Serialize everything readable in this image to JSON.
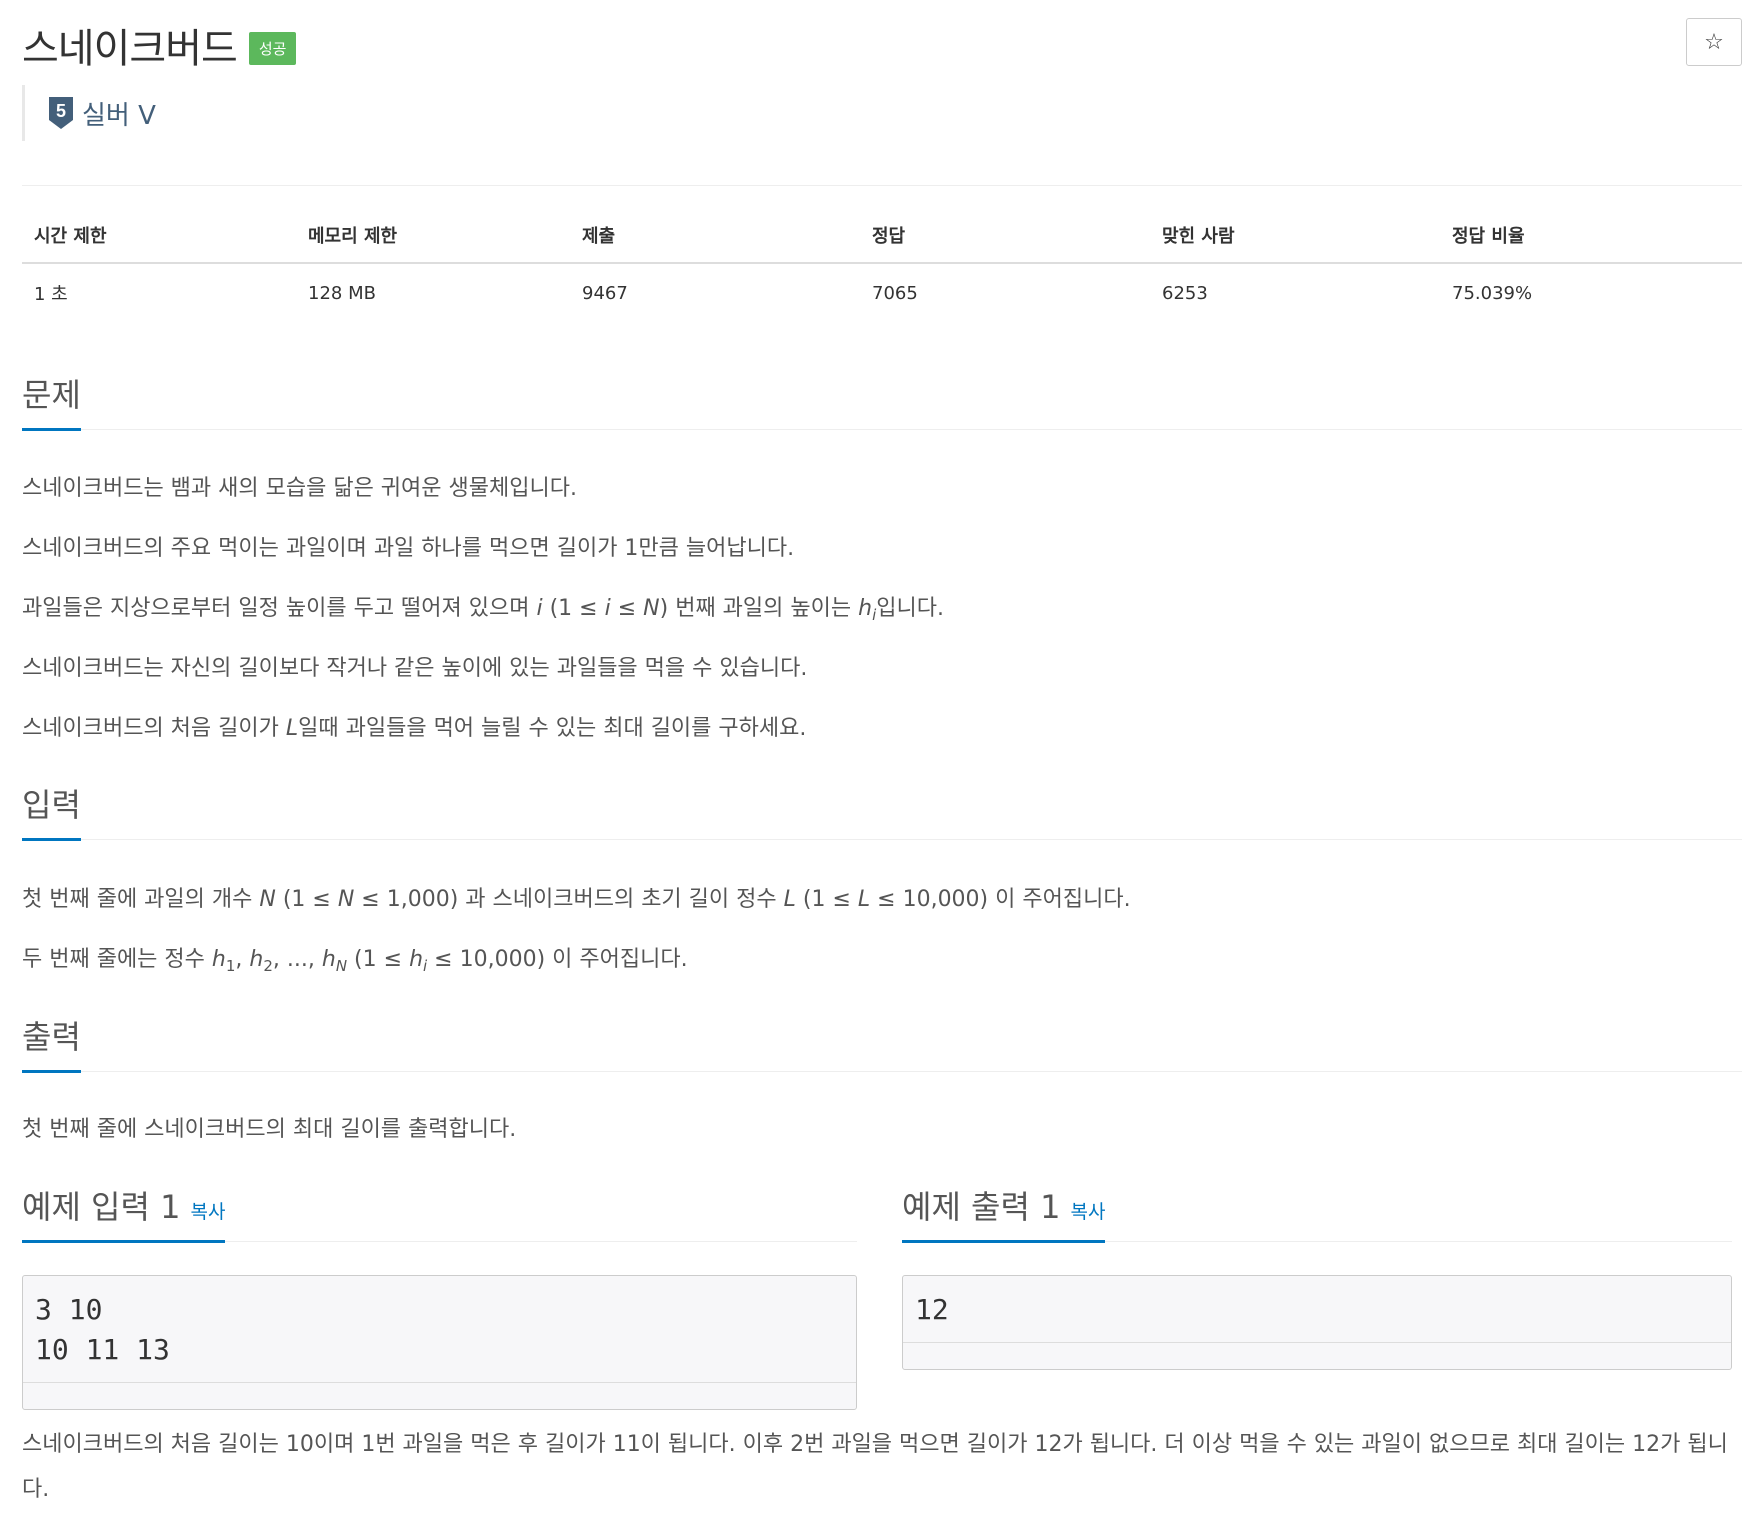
{
  "problem": {
    "title": "스네이크버드",
    "badge": "성공",
    "tier_number": "5",
    "tier_label": "실버 V",
    "star_icon": "☆"
  },
  "info_table": {
    "headers": [
      "시간 제한",
      "메모리 제한",
      "제출",
      "정답",
      "맞힌 사람",
      "정답 비율"
    ],
    "values": [
      "1 초",
      "128 MB",
      "9467",
      "7065",
      "6253",
      "75.039%"
    ]
  },
  "sections": {
    "description_title": "문제",
    "input_title": "입력",
    "output_title": "출력"
  },
  "description": {
    "line1": "스네이크버드는 뱀과 새의 모습을 닮은 귀여운 생물체입니다.",
    "line2": "스네이크버드의 주요 먹이는 과일이며 과일 하나를 먹으면 길이가 1만큼 늘어납니다.",
    "line3_a": "과일들은 지상으로부터 일정 높이를 두고 떨어져 있으며 ",
    "line3_i": "i",
    "line3_b": " (1 ≤ ",
    "line3_i2": "i",
    "line3_c": " ≤ ",
    "line3_n": "N",
    "line3_d": ") 번째 과일의 높이는 ",
    "line3_h": "h",
    "line3_sub": "i",
    "line3_e": "입니다.",
    "line4": "스네이크버드는 자신의 길이보다 작거나 같은 높이에 있는 과일들을 먹을 수 있습니다.",
    "line5_a": "스네이크버드의 처음 길이가 ",
    "line5_l": "L",
    "line5_b": "일때 과일들을 먹어 늘릴 수 있는 최대 길이를 구하세요."
  },
  "input": {
    "line1_a": "첫 번째 줄에 과일의 개수 ",
    "line1_n": "N",
    "line1_b": " (1 ≤ ",
    "line1_n2": "N",
    "line1_c": " ≤ 1,000) 과 스네이크버드의 초기 길이 정수 ",
    "line1_l": "L",
    "line1_d": " (1 ≤ ",
    "line1_l2": "L",
    "line1_e": " ≤ 10,000) 이 주어집니다.",
    "line2_a": "두 번째 줄에는 정수 ",
    "h": "h",
    "sub1": "1",
    "sub2": "2",
    "subN": "N",
    "subi": "i",
    "comma": ", ",
    "ellipsis": "..., ",
    "line2_b": " (1 ≤ ",
    "line2_c": " ≤ 10,000) 이 주어집니다."
  },
  "output": {
    "line1": "첫 번째 줄에 스네이크버드의 최대 길이를 출력합니다."
  },
  "example": {
    "input_title": "예제 입력 1",
    "output_title": "예제 출력 1",
    "copy_label": "복사",
    "input_text": "3 10\n10 11 13",
    "output_text": "12",
    "note": "스네이크버드의 처음 길이는 10이며 1번 과일을 먹은 후 길이가 11이 됩니다. 이후 2번 과일을 먹으면 길이가 12가 됩니다. 더 이상 먹을 수 있는 과일이 없으므로 최대 길이는 12가 됩니다."
  }
}
